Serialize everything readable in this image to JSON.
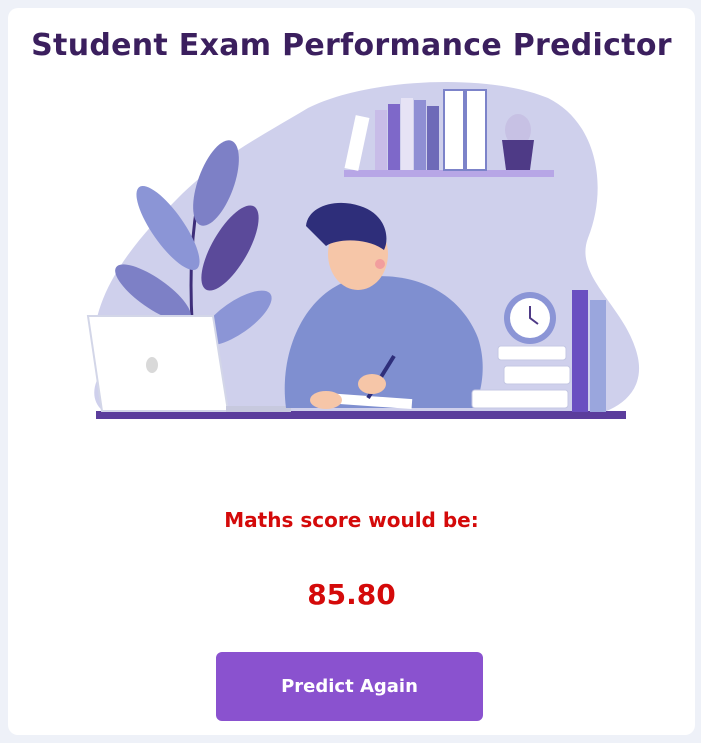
{
  "header": {
    "title": "Student Exam Performance Predictor"
  },
  "illustration": {
    "icon": "student-studying-illustration"
  },
  "result": {
    "label": "Maths score would be:",
    "value": "85.80"
  },
  "actions": {
    "predict_again_label": "Predict Again"
  },
  "colors": {
    "title": "#3b1f5e",
    "result": "#d40a0a",
    "button": "#8a52cf",
    "blob": "#cfd0ec"
  }
}
